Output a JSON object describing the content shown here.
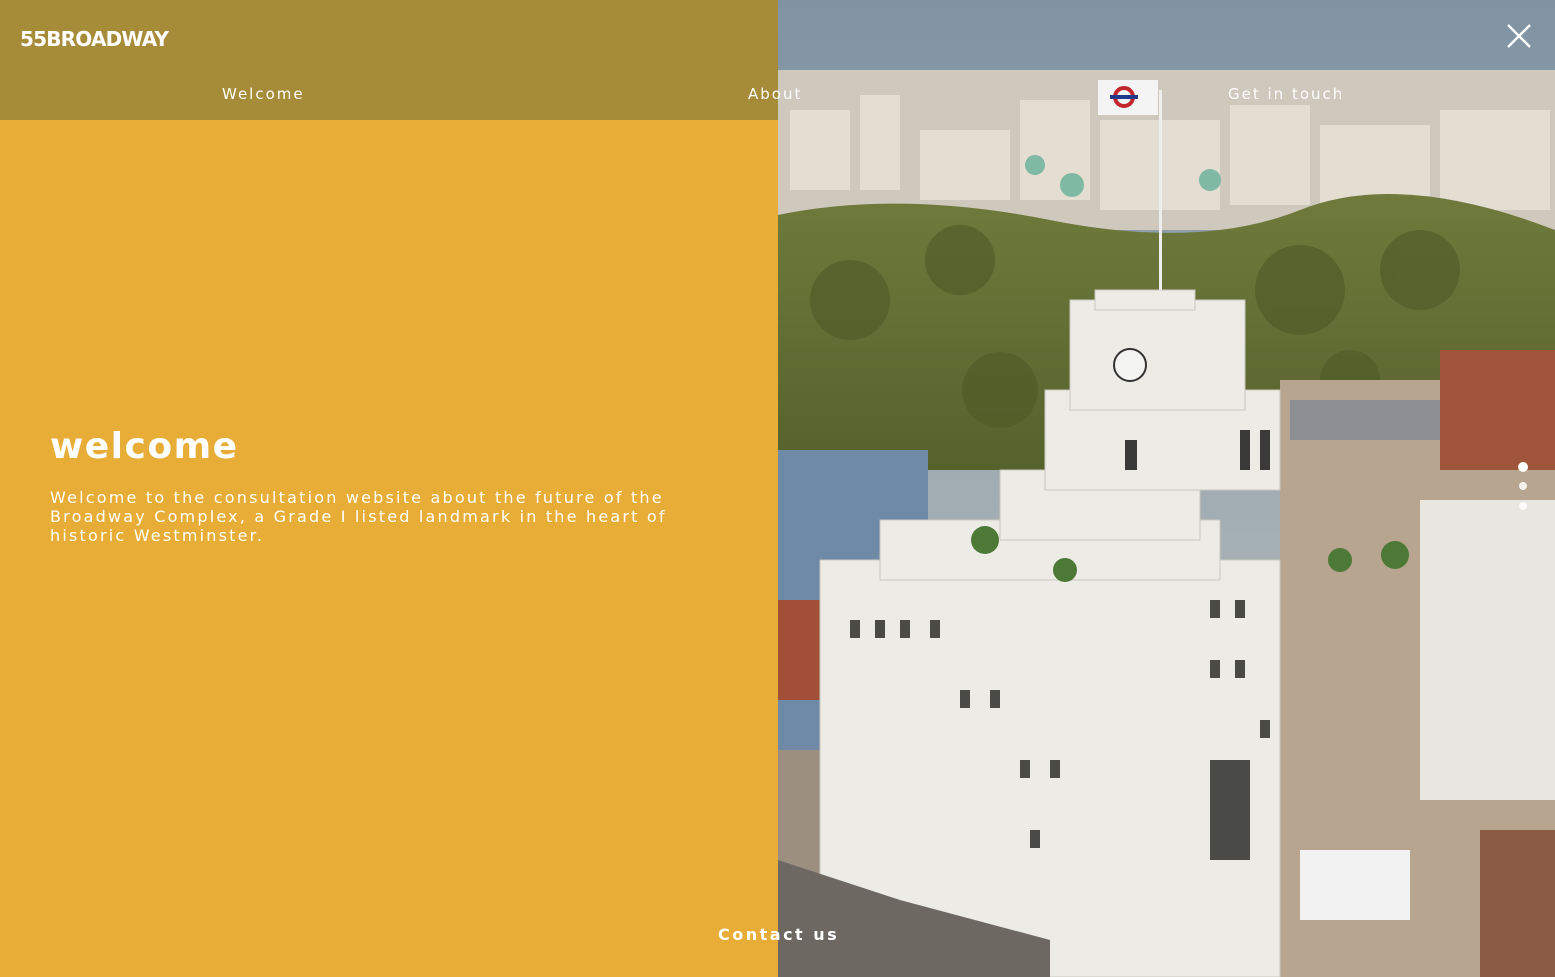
{
  "brand": {
    "logo_text": "55BROADWAY"
  },
  "nav": {
    "items": [
      {
        "label": "Welcome"
      },
      {
        "label": "About"
      },
      {
        "label": "Get in touch"
      }
    ]
  },
  "hero": {
    "title": "welcome",
    "body": "Welcome to the consultation website about the future of the Broadway Complex, a Grade I listed landmark in the heart of historic Westminster."
  },
  "footer": {
    "contact_label": "Contact us"
  },
  "icons": {
    "close": "close-icon"
  },
  "colors": {
    "panel_yellow": "#e8ad37",
    "header_olive": "#a68b38",
    "text_white": "#ffffff"
  }
}
